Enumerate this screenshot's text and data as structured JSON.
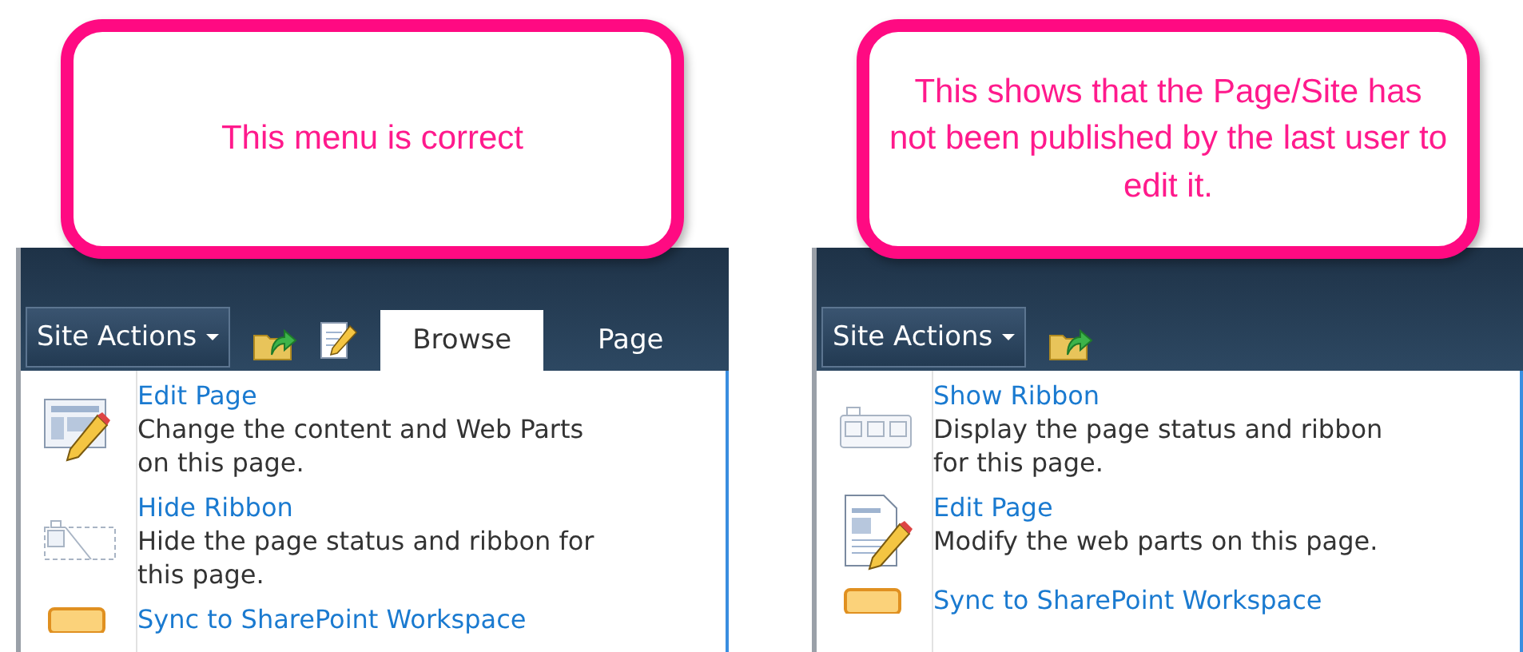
{
  "panels": [
    {
      "callout": "This menu is correct",
      "site_actions": "Site Actions",
      "toolbar_buttons": [
        {
          "kind": "upload"
        },
        {
          "kind": "edit"
        }
      ],
      "tabs": [
        {
          "label": "Browse",
          "selected": true
        },
        {
          "label": "Page",
          "selected": false
        }
      ],
      "menu_items": [
        {
          "kind": "edit-page",
          "title": "Edit Page",
          "description": "Change the content and Web Parts on this page."
        },
        {
          "kind": "hide-ribbon",
          "title": "Hide Ribbon",
          "description": "Hide the page status and ribbon for this page."
        },
        {
          "kind": "sync",
          "title": "Sync to SharePoint Workspace"
        }
      ]
    },
    {
      "callout": "This shows that the Page/Site has not been published by the last user to edit it.",
      "site_actions": "Site Actions",
      "toolbar_buttons": [
        {
          "kind": "upload"
        }
      ],
      "menu_items": [
        {
          "kind": "show-ribbon",
          "title": "Show Ribbon",
          "description": "Display the page status and ribbon for this page."
        },
        {
          "kind": "edit-doc",
          "title": "Edit Page",
          "description": "Modify the web parts on this page."
        },
        {
          "kind": "sync",
          "title": "Sync to SharePoint Workspace"
        }
      ]
    }
  ]
}
